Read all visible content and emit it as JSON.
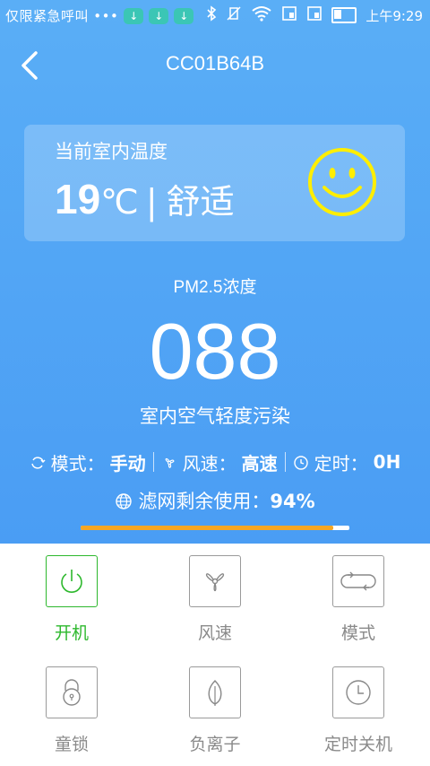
{
  "statusbar": {
    "carrier": "仅限紧急呼叫 •••",
    "time": "上午9:29"
  },
  "header": {
    "title": "CC01B64B"
  },
  "temperature": {
    "label": "当前室内温度",
    "value": "19",
    "unit": "℃",
    "separator": "|",
    "comfort": "舒适"
  },
  "pm25": {
    "label": "PM2.5浓度",
    "value": "088",
    "status": "室内空气轻度污染"
  },
  "info": {
    "mode_label": "模式：",
    "mode_value": "手动",
    "speed_label": "风速：",
    "speed_value": "高速",
    "timer_label": "定时：",
    "timer_value": "0H"
  },
  "filter": {
    "label": "滤网剩余使用：",
    "value": "94%",
    "fraction": 0.94
  },
  "controls": [
    {
      "label": "开机",
      "active": true
    },
    {
      "label": "风速",
      "active": false
    },
    {
      "label": "模式",
      "active": false
    },
    {
      "label": "童锁",
      "active": false
    },
    {
      "label": "负离子",
      "active": false
    },
    {
      "label": "定时关机",
      "active": false
    }
  ],
  "colors": {
    "accent_green": "#2db82d",
    "progress_orange": "#f5a623",
    "smile_yellow": "#ffee00"
  }
}
